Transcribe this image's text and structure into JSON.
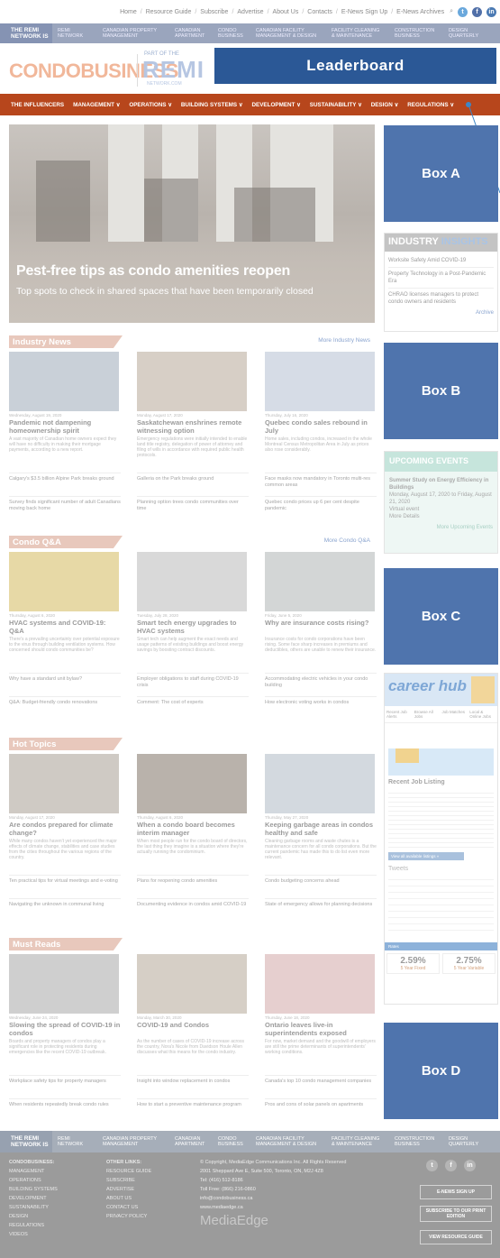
{
  "topbar": {
    "links": [
      "Home",
      "Resource Guide",
      "Subscribe",
      "Advertise",
      "About Us",
      "Contacts",
      "E-News Sign Up",
      "E-News Archives"
    ]
  },
  "remi_network": {
    "logo": "THE REMI NETWORK IS",
    "items": [
      "REMI NETWORK",
      "CANADIAN PROPERTY MANAGEMENT",
      "CANADIAN APARTMENT",
      "CONDO BUSINESS",
      "CANADIAN FACILITY MANAGEMENT & DESIGN",
      "FACILITY CLEANING & MAINTENANCE",
      "CONSTRUCTION BUSINESS",
      "DESIGN QUARTERLY"
    ]
  },
  "header": {
    "brand": "CONDOBUSINESS",
    "part_of": "PART OF THE",
    "remi": "REMI",
    "remi_sub": "NETWORK.COM",
    "leaderboard": "Leaderboard"
  },
  "nav": [
    "THE INFLUENCERS",
    "MANAGEMENT ∨",
    "OPERATIONS ∨",
    "BUILDING SYSTEMS ∨",
    "DEVELOPMENT ∨",
    "SUSTAINABILITY ∨",
    "DESIGN ∨",
    "REGULATIONS ∨"
  ],
  "hero": {
    "title": "Pest-free tips as condo amenities reopen",
    "subtitle": "Top spots to check in shared spaces that have been temporarily closed"
  },
  "sections": [
    {
      "heading": "Industry News",
      "more": "More Industry News",
      "articles": [
        {
          "meta": "Wednesday, August 19, 2020",
          "title": "Pandemic not dampening homeownership spirit",
          "desc": "A vast majority of Canadian home owners expect they will have no difficulty in making their mortgage payments, according to a new report."
        },
        {
          "meta": "Monday, August 17, 2020",
          "title": "Saskatchewan enshrines remote witnessing option",
          "desc": "Emergency regulations were initially intended to enable land title registry, delegation of power of attorney and filing of wills in accordance with required public health protocols."
        },
        {
          "meta": "Thursday, July 16, 2020",
          "title": "Quebec condo sales rebound in July",
          "desc": "Home sales, including condos, increased in the whole Montreal Census Metropolitan Area in July as prices also rose considerably."
        }
      ],
      "links": [
        [
          "Calgary's $3.5 billion Alpine Park breaks ground",
          "Galleria on the Park breaks ground",
          "Face masks now mandatory in Toronto multi-res common areas"
        ],
        [
          "Survey finds significant number of adult Canadians moving back home",
          "Planning option trees condo communities over time",
          "Quebec condo prices up 6 per cent despite pandemic"
        ]
      ]
    },
    {
      "heading": "Condo Q&A",
      "more": "More Condo Q&A",
      "articles": [
        {
          "meta": "Thursday, August 6, 2020",
          "title": "HVAC systems and COVID-19: Q&A",
          "desc": "There's a prevailing uncertainty over potential exposure to the virus through building ventilation systems. How concerned should condo communities be?"
        },
        {
          "meta": "Tuesday, July 28, 2020",
          "title": "Smart tech energy upgrades to HVAC systems",
          "desc": "Smart tech can help augment the exact needs and usage patterns of existing buildings and boost energy savings by boosting contract discounts."
        },
        {
          "meta": "Friday, June 5, 2020",
          "title": "Why are insurance costs rising?",
          "desc": "Insurance costs for condo corporations have been rising. Some face sharp increases in premiums and deductibles, others are unable to renew their insurance."
        }
      ],
      "links": [
        [
          "Why have a standard unit bylaw?",
          "Employer obligations to staff during COVID-19 crisis",
          "Accommodating electric vehicles in your condo building"
        ],
        [
          "Q&A: Budget-friendly condo renovations",
          "Comment: The cost of experts",
          "How electronic voting works in condos"
        ]
      ]
    },
    {
      "heading": "Hot Topics",
      "more": "",
      "articles": [
        {
          "meta": "Monday, August 17, 2020",
          "title": "Are condos prepared for climate change?",
          "desc": "While many condos haven't yet experienced the major effects of climate change, stabilities and case studies from the cities throughout the various regions of the country."
        },
        {
          "meta": "Thursday, August 6, 2020",
          "title": "When a condo board becomes interim manager",
          "desc": "When most people run for the condo board of directors, the last thing they imagine is a situation where they're actually running the condominium."
        },
        {
          "meta": "Thursday, May 27, 2020",
          "title": "Keeping garbage areas in condos healthy and safe",
          "desc": "Cleaning garbage rooms and waste chutes is a maintenance concern for all condo corporations. But the current pandemic has made this to do list even more relevant."
        }
      ],
      "links": [
        [
          "Ten practical tips for virtual meetings and e-voting",
          "Plans for reopening condo amenities",
          "Condo budgeting concerns ahead"
        ],
        [
          "Navigating the unknown in communal living",
          "Documenting evidence in condos amid COVID-19",
          "State of emergency allows for planning decisions"
        ]
      ]
    },
    {
      "heading": "Must Reads",
      "more": "",
      "articles": [
        {
          "meta": "Wednesday, June 24, 2020",
          "title": "Slowing the spread of COVID-19 in condos",
          "desc": "Boards and property managers of condos play a significant role in protecting residents during emergencies like the recent COVID-19 outbreak."
        },
        {
          "meta": "Monday, March 30, 2020",
          "title": "COVID-19 and Condos",
          "desc": "As the number of cases of COVID-19 increase across the country, Nora's Nicole from Davidson Houle Allen discusses what this means for the condo industry."
        },
        {
          "meta": "Thursday, June 18, 2020",
          "title": "Ontario leaves live-in superintendents exposed",
          "desc": "For now, market demand and the goodwill of employers are still the prime determinants of superintendents' working conditions."
        }
      ],
      "links": [
        [
          "Workplace safety tips for property managers",
          "Insight into window replacement in condos",
          "Canada's top 10 condo management companies"
        ],
        [
          "When residents repeatedly break condo rules",
          "How to start a preventive maintenance program",
          "Pros and cons of solar panels on apartments"
        ]
      ]
    }
  ],
  "sidebar": {
    "box_a": "Box A",
    "box_b": "Box B",
    "box_c": "Box C",
    "box_d": "Box D",
    "insights": {
      "title_a": "INDUSTRY",
      "title_b": "INSIGHTS",
      "items": [
        "Worksite Safety Amid COVID-19",
        "Property Technology in a Post-Pandemic Era",
        "CHRAO licenses managers to protect condo owners and residents"
      ],
      "archive": "Archive"
    },
    "events": {
      "title": "UPCOMING EVENTS",
      "event_title": "Summer Study on Energy Efficiency in Buildings",
      "event_date": "Monday, August 17, 2020 to Friday, August 21, 2020",
      "event_loc": "Virtual event",
      "more_details": "More Details",
      "more_link": "More Upcoming Events"
    },
    "careerhub": {
      "logo": "career hub",
      "tabs": [
        "Recent Job Alerts",
        "Browse All Jobs",
        "Job Matches",
        "Local & Online Jobs"
      ],
      "recent": "Recent Job Listing",
      "view_all": "View all available listings »",
      "tweets": "Tweets",
      "rates_title": "Rates",
      "rate1": "2.59%",
      "rate1_label": "5 Year Fixed",
      "rate2": "2.75%",
      "rate2_label": "5 Year Variable"
    }
  },
  "footer": {
    "col1": [
      "CONDOBUSINESS:",
      "MANAGEMENT",
      "OPERATIONS",
      "BUILDING SYSTEMS",
      "DEVELOPMENT",
      "SUSTAINABILITY",
      "DESIGN",
      "REGULATIONS",
      "VIDEOS"
    ],
    "col2": [
      "OTHER LINKS:",
      "RESOURCE GUIDE",
      "SUBSCRIBE",
      "ADVERTISE",
      "ABOUT US",
      "CONTACT US",
      "PRIVACY POLICY"
    ],
    "copyright": "© Copyright, MediaEdge Communications Inc. All Rights Reserved",
    "address": "2001 Sheppard Ave E, Suite 500, Toronto, ON, M2J 4Z8",
    "tel": "Tel: (416) 512-8186",
    "tollfree": "Toll Free: (866) 216-0860",
    "email": "info@condobusiness.ca",
    "web": "www.mediaedge.ca",
    "mediaedge": "MediaEdge",
    "buttons": [
      "E-NEWS SIGN UP",
      "SUBSCRIBE TO OUR PRINT EDITION",
      "VIEW RESOURCE GUIDE"
    ]
  }
}
